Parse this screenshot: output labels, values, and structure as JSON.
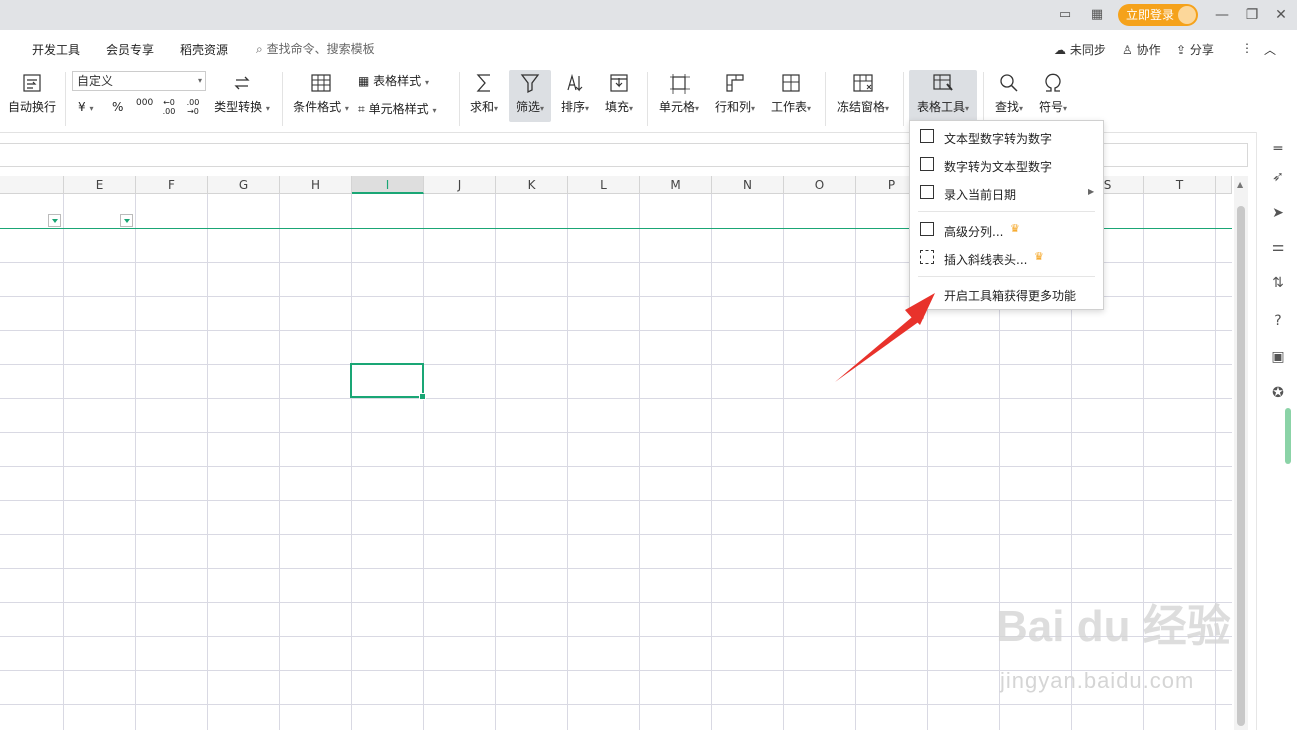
{
  "titlebar": {
    "login_label": "立即登录"
  },
  "menubar": {
    "tabs": [
      "开发工具",
      "会员专享",
      "稻壳资源"
    ],
    "search_placeholder": "查找命令、搜索模板",
    "sync": "未同步",
    "collab": "协作",
    "share": "分享"
  },
  "ribbon": {
    "wrap": "自动换行",
    "number_format": "自定义",
    "currency": "¥",
    "percent": "%",
    "thousands": "000",
    "dec_inc": "←0 .00",
    "dec_dec": ".00 →0",
    "type_convert": "类型转换",
    "cond_format": "条件格式",
    "table_style": "表格样式",
    "cell_style": "单元格样式",
    "sum": "求和",
    "filter": "筛选",
    "sort": "排序",
    "fill": "填充",
    "cell": "单元格",
    "row_col": "行和列",
    "worksheet": "工作表",
    "freeze": "冻结窗格",
    "table_tools": "表格工具",
    "find": "查找",
    "symbol": "符号"
  },
  "columns": [
    "E",
    "F",
    "G",
    "H",
    "I",
    "J",
    "K",
    "L",
    "M",
    "N",
    "O",
    "P",
    "S",
    "T"
  ],
  "selected_column": "I",
  "dropdown": {
    "items": [
      {
        "label": "文本型数字转为数字",
        "icon": "text-to-number-icon"
      },
      {
        "label": "数字转为文本型数字",
        "icon": "number-to-text-icon"
      },
      {
        "label": "录入当前日期",
        "icon": "calendar-icon"
      },
      {
        "label": "高级分列...",
        "icon": "split-column-icon"
      },
      {
        "label": "插入斜线表头...",
        "icon": "diagonal-header-icon"
      },
      {
        "label": "开启工具箱获得更多功能",
        "icon": ""
      }
    ]
  },
  "watermark": {
    "brand": "Bai du 经验",
    "url": "jingyan.baidu.com"
  },
  "colors": {
    "accent_green": "#1aa675",
    "login_orange": "#f5a21b",
    "arrow_red": "#e8322b"
  }
}
